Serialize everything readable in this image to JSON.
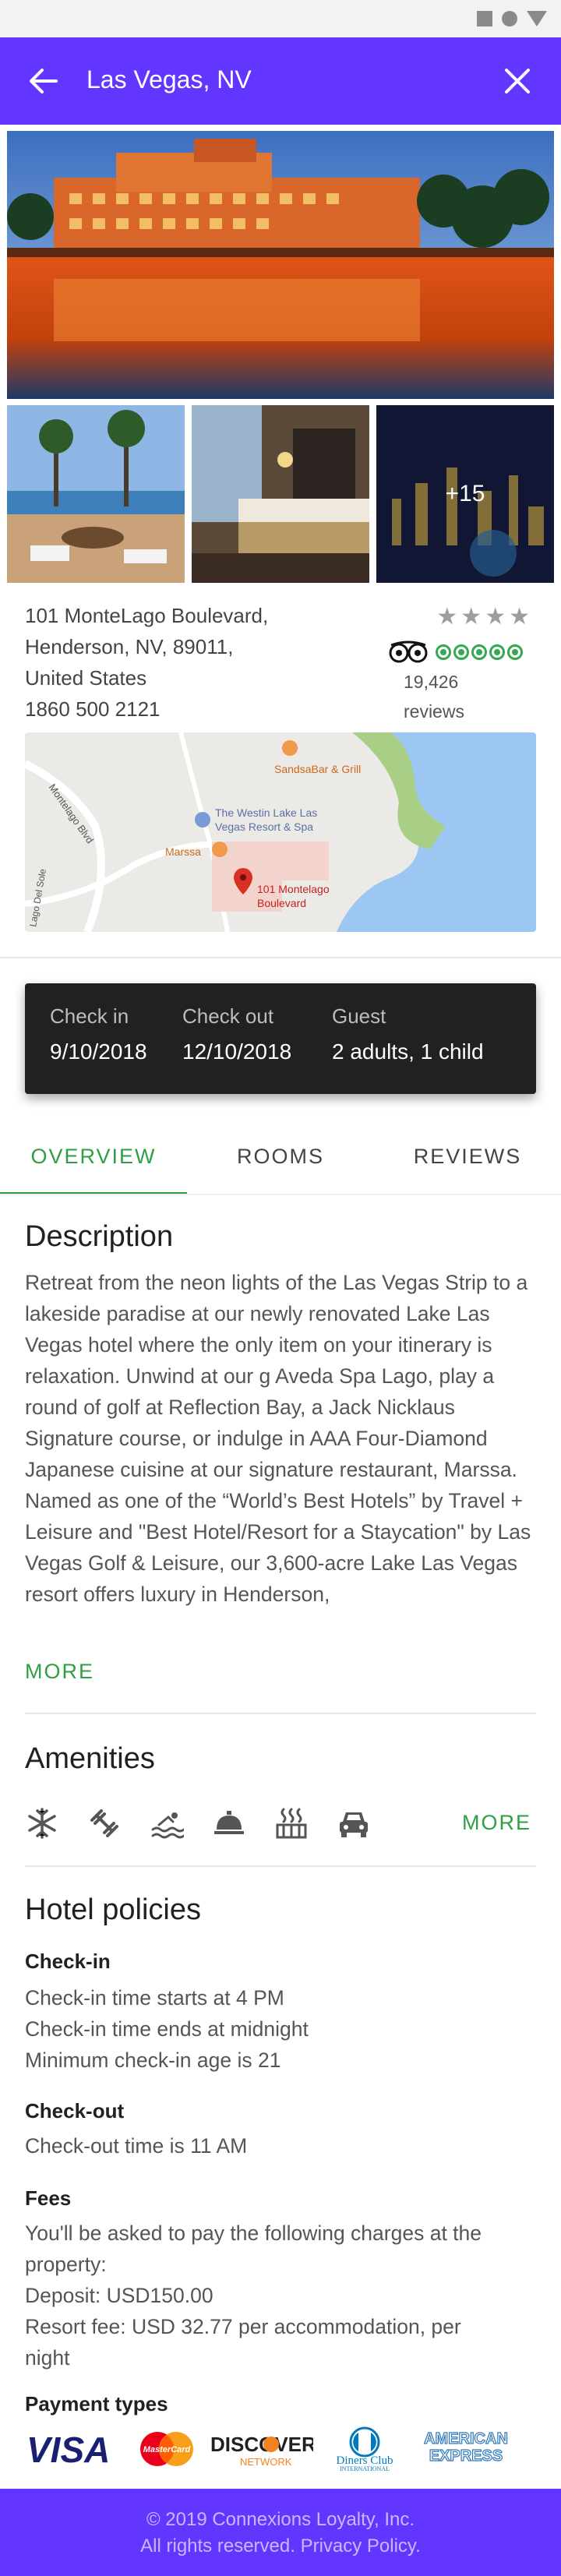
{
  "status_bar": {
    "icons": [
      "square-icon",
      "circle-icon",
      "triangle-icon"
    ]
  },
  "app_bar": {
    "title": "Las Vegas, NV",
    "back_icon": "arrow-left-icon",
    "close_icon": "close-icon",
    "color": "#6236ff"
  },
  "gallery": {
    "more_count": "+15"
  },
  "hotel": {
    "address_lines": [
      "101 MonteLago Boulevard,",
      "Henderson, NV, 89011,",
      "United States"
    ],
    "phone": "1860 500 2121",
    "star_rating": 4,
    "tripadvisor_rating": 5,
    "review_count": "19,426",
    "reviews_label": "reviews"
  },
  "map": {
    "poi_1": "SandsaBar & Grill",
    "poi_2_line1": "The Westin Lake Las",
    "poi_2_line2": "Vegas Resort & Spa",
    "poi_3": "Marssa",
    "pin_line1": "101 Montelago",
    "pin_line2": "Boulevard",
    "road_1": "Montelago Blvd",
    "road_2": "Lago Del Sole"
  },
  "booking": {
    "check_in_label": "Check in",
    "check_in_value": "9/10/2018",
    "check_out_label": "Check out",
    "check_out_value": "12/10/2018",
    "guest_label": "Guest",
    "guest_value": "2 adults, 1 child"
  },
  "tabs": [
    {
      "label": "OVERVIEW",
      "active": true
    },
    {
      "label": "ROOMS",
      "active": false
    },
    {
      "label": "REVIEWS",
      "active": false
    }
  ],
  "description": {
    "heading": "Description",
    "text": "Retreat from the neon lights of the Las Vegas Strip to a lakeside paradise at our newly renovated Lake Las Vegas hotel where the only item on your itinerary is relaxation. Unwind at our g Aveda Spa Lago, play a round of golf at Reflection Bay, a Jack Nicklaus Signature course, or indulge in AAA Four-Diamond Japanese cuisine at our signature restaurant, Marssa. Named as one of the “World’s Best Hotels” by Travel + Leisure and \"Best Hotel/Resort for a Staycation\" by Las Vegas Golf & Leisure, our 3,600-acre Lake Las Vegas resort offers luxury in Henderson,",
    "more": "MORE"
  },
  "amenities": {
    "heading": "Amenities",
    "icons": [
      "snowflake-icon",
      "fitness-icon",
      "pool-icon",
      "room-service-icon",
      "spa-icon",
      "car-icon"
    ],
    "more": "MORE"
  },
  "policies": {
    "heading": "Hotel policies",
    "check_in_heading": "Check-in",
    "check_in_lines": [
      "Check-in time starts at 4 PM",
      "Check-in time ends at midnight",
      "Minimum check-in age is 21"
    ],
    "check_out_heading": "Check-out",
    "check_out_lines": [
      "Check-out time is 11 AM"
    ],
    "fees_heading": "Fees",
    "fees_lines": [
      "You'll be asked to pay the following charges at the",
      "property:",
      "Deposit: USD150.00",
      "Resort fee: USD 32.77 per accommodation, per",
      "night"
    ],
    "payment_heading": "Payment types",
    "payment": {
      "visa": "VISA",
      "mastercard": "MasterCard",
      "discover_1": "DISCOVER",
      "discover_2": "NETWORK",
      "diners_1": "Diners Club",
      "diners_2": "INTERNATIONAL",
      "amex_1": "AMERICAN",
      "amex_2": "EXPRESS"
    }
  },
  "footer": {
    "line1": "© 2019 Connexions Loyalty, Inc.",
    "line2": "All rights reserved. Privacy Policy."
  },
  "colors": {
    "accent_green": "#2ea043",
    "brand_purple": "#6236ff",
    "booking_bg": "#212121"
  }
}
